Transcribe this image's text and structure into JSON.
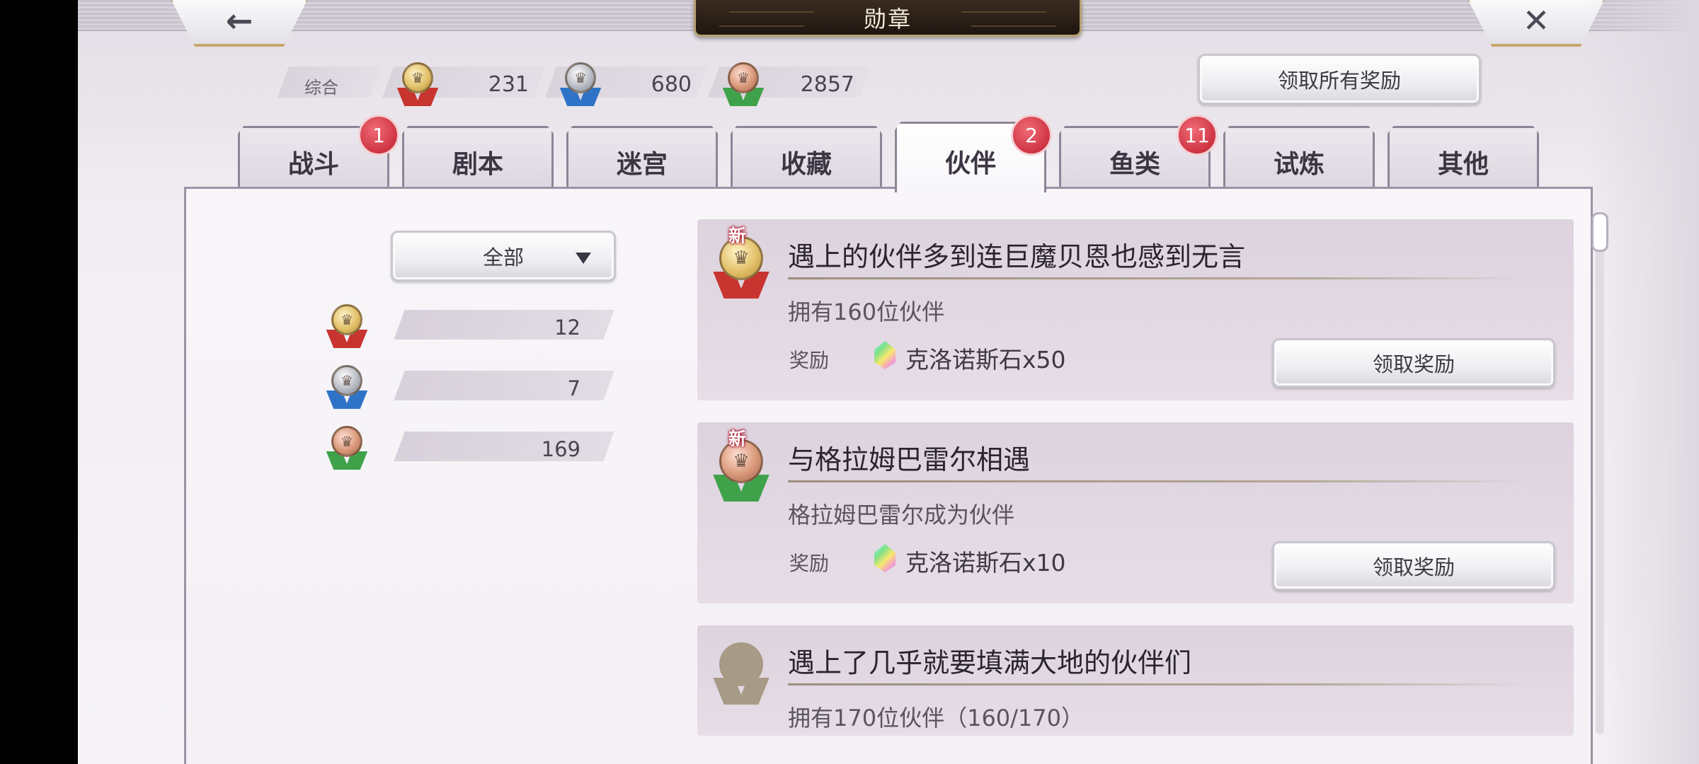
{
  "header": {
    "title": "勋章",
    "back_glyph": "←",
    "close_glyph": "✕"
  },
  "summary": {
    "label": "综合",
    "gold": "231",
    "silver": "680",
    "bronze": "2857",
    "claim_all_label": "领取所有奖励"
  },
  "tabs": [
    {
      "label": "战斗",
      "badge": "1"
    },
    {
      "label": "剧本",
      "badge": ""
    },
    {
      "label": "迷宫",
      "badge": ""
    },
    {
      "label": "收藏",
      "badge": ""
    },
    {
      "label": "伙伴",
      "badge": "2",
      "active": true
    },
    {
      "label": "鱼类",
      "badge": "11"
    },
    {
      "label": "试炼",
      "badge": ""
    },
    {
      "label": "其他",
      "badge": ""
    }
  ],
  "filter": {
    "selected": "全部",
    "gold_count": "12",
    "silver_count": "7",
    "bronze_count": "169"
  },
  "cards": [
    {
      "new_tag": "新",
      "medal": "gold",
      "title": "遇上的伙伴多到连巨魔贝恩也感到无言",
      "desc": "拥有160位伙伴",
      "reward_label": "奖励",
      "reward": "克洛诺斯石x50",
      "button": "领取奖励"
    },
    {
      "new_tag": "新",
      "medal": "bronze",
      "title": "与格拉姆巴雷尔相遇",
      "desc": "格拉姆巴雷尔成为伙伴",
      "reward_label": "奖励",
      "reward": "克洛诺斯石x10",
      "button": "领取奖励"
    },
    {
      "medal": "locked",
      "title": "遇上了几乎就要填满大地的伙伴们",
      "desc": "拥有170位伙伴（160/170）"
    }
  ],
  "colors": {
    "accent_gold": "#c6a86b",
    "badge_red": "#cf3443",
    "ribbon_gold": "#c8342f",
    "ribbon_silver": "#2f73c7",
    "ribbon_bronze": "#3fa24a"
  },
  "icons": {
    "back": "arrow-left-icon",
    "close": "close-icon",
    "dropdown": "triangle-down-icon",
    "reward": "chronos-stone-icon"
  }
}
